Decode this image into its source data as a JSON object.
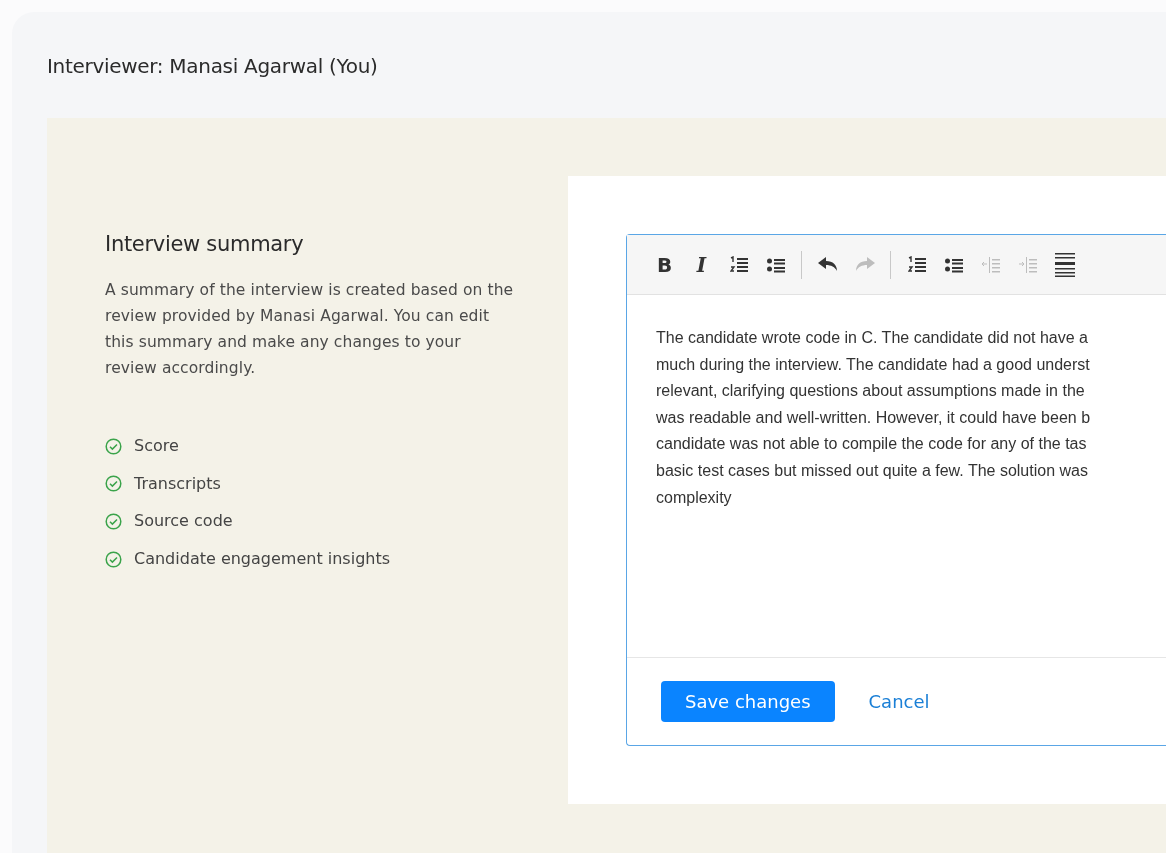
{
  "header": {
    "title": "Interviewer: Manasi Agarwal (You)"
  },
  "summary": {
    "heading": "Interview summary",
    "description": "A summary of the interview is created based on the review provided by Manasi Agarwal. You can edit this summary and make any changes to your review accordingly.",
    "items": [
      {
        "label": "Score",
        "checked": true
      },
      {
        "label": "Transcripts",
        "checked": true
      },
      {
        "label": "Source code",
        "checked": true
      },
      {
        "label": "Candidate engagement insights",
        "checked": true
      }
    ]
  },
  "editor": {
    "toolbar": [
      {
        "kind": "bold",
        "text": "B",
        "disabled": false
      },
      {
        "kind": "italic",
        "text": "I",
        "disabled": false
      },
      {
        "kind": "numbered-list",
        "disabled": false
      },
      {
        "kind": "bullet-list",
        "disabled": false
      },
      {
        "kind": "separator"
      },
      {
        "kind": "undo",
        "disabled": false
      },
      {
        "kind": "redo",
        "disabled": true
      },
      {
        "kind": "separator"
      },
      {
        "kind": "numbered-list",
        "disabled": false
      },
      {
        "kind": "bullet-list",
        "disabled": false
      },
      {
        "kind": "outdent",
        "disabled": true
      },
      {
        "kind": "indent",
        "disabled": true
      },
      {
        "kind": "horizontal-rule",
        "disabled": false
      }
    ],
    "lines": [
      "The candidate wrote code in C. The candidate did not have a",
      "much during the interview. The candidate had a good underst",
      "relevant, clarifying questions about assumptions made in the",
      "was readable and well-written. However, it could have been b",
      "candidate was not able to compile the code for any of the tas",
      "basic test cases but missed out quite a few. The solution was",
      "complexity"
    ],
    "save_button": "Save changes",
    "cancel_link": "Cancel"
  }
}
